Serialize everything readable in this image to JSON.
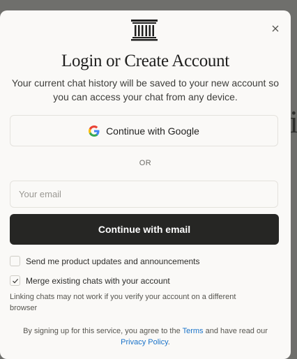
{
  "modal": {
    "title": "Login or Create Account",
    "subtitle": "Your current chat history will be saved to your new account so you can access your chat from any device.",
    "google_button_label": "Continue with Google",
    "divider_text": "OR",
    "email": {
      "value": "",
      "placeholder": "Your email"
    },
    "email_button_label": "Continue with email",
    "options": [
      {
        "label": "Send me product updates and announcements",
        "checked": false
      },
      {
        "label": "Merge existing chats with your account",
        "checked": true
      }
    ],
    "note": "Linking chats may not work if you verify your account on a different browser",
    "legal": {
      "prefix": "By signing up for this service, you agree to the",
      "terms_label": "Terms",
      "middle": "and have read our",
      "privacy_label": "Privacy Policy",
      "suffix": "."
    }
  },
  "backdrop": {
    "visible_text": "i"
  },
  "colors": {
    "primary_button": "#262624",
    "link": "#1a73c9",
    "surface": "#faf9f7"
  },
  "icons": {
    "logo": "pillar-logo-icon",
    "close": "close-icon",
    "google": "google-icon",
    "check": "check-icon"
  }
}
